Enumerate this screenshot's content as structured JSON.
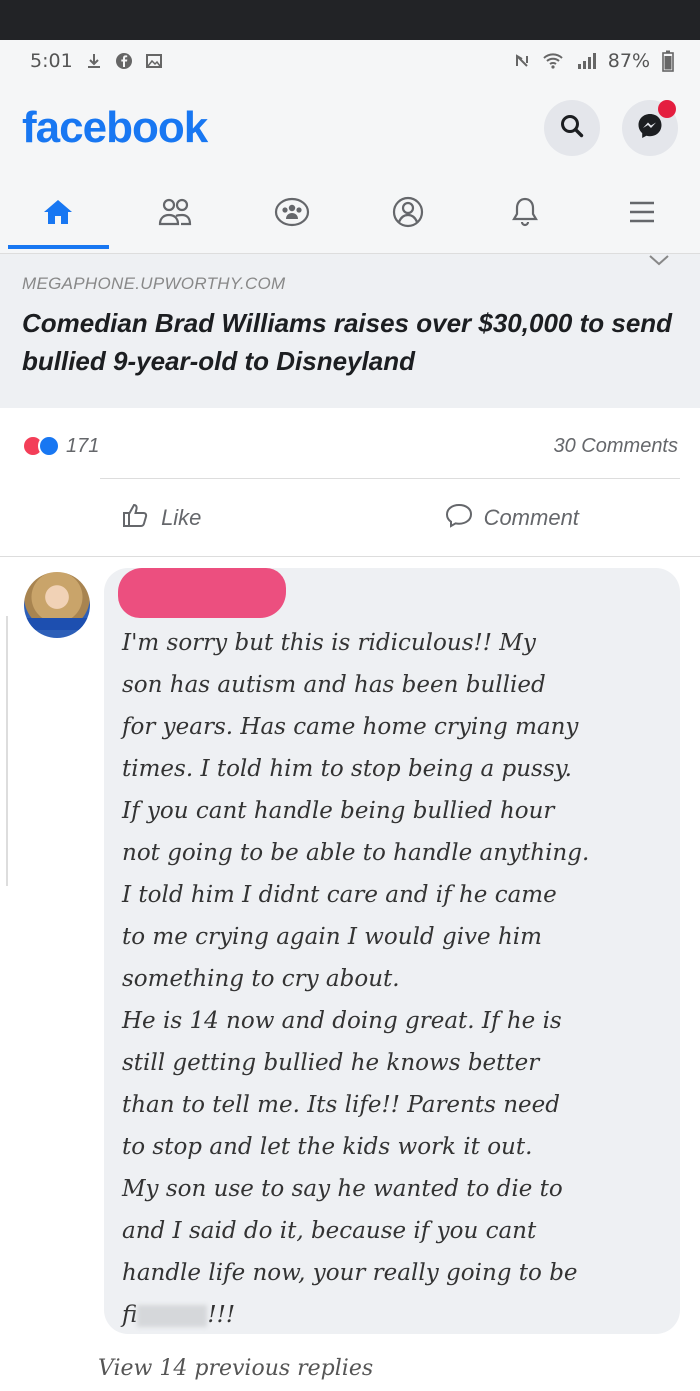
{
  "status_bar": {
    "time": "5:01",
    "battery": "87%"
  },
  "header": {
    "logo": "facebook"
  },
  "tabs": [
    "home-icon",
    "friends-icon",
    "groups-icon",
    "profile-icon",
    "bell-icon",
    "menu-icon"
  ],
  "link_card": {
    "domain": "MEGAPHONE.UPWORTHY.COM",
    "title": "Comedian Brad Williams raises over $30,000 to send bullied 9-year-old to Disneyland"
  },
  "stats": {
    "reaction_count": "171",
    "comments": "30 Comments"
  },
  "actions": {
    "like": "Like",
    "comment": "Comment"
  },
  "comment": {
    "text": "I'm sorry but this is ridiculous!! My\nson has autism and has been bullied\nfor years. Has came home crying many\ntimes. I told him to stop being a pussy.\nIf you cant handle being bullied hour\nnot going to be able to handle anything.\nI told him I didnt care and if he came\nto me crying again I would give him\nsomething to cry about.\nHe is 14 now and doing great. If he is\nstill getting bullied he knows better\nthan to tell me. Its life!! Parents need\nto stop and let the kids work it out.\nMy son use to say he wanted to die to\nand I said do it, because if you cant\nhandle life now, your really going to be",
    "last_line_start": "fi",
    "last_line_end": "!!!"
  },
  "view_replies": "View 14 previous replies",
  "colors": {
    "brand": "#1877f2",
    "redaction": "#ec4f7f"
  }
}
